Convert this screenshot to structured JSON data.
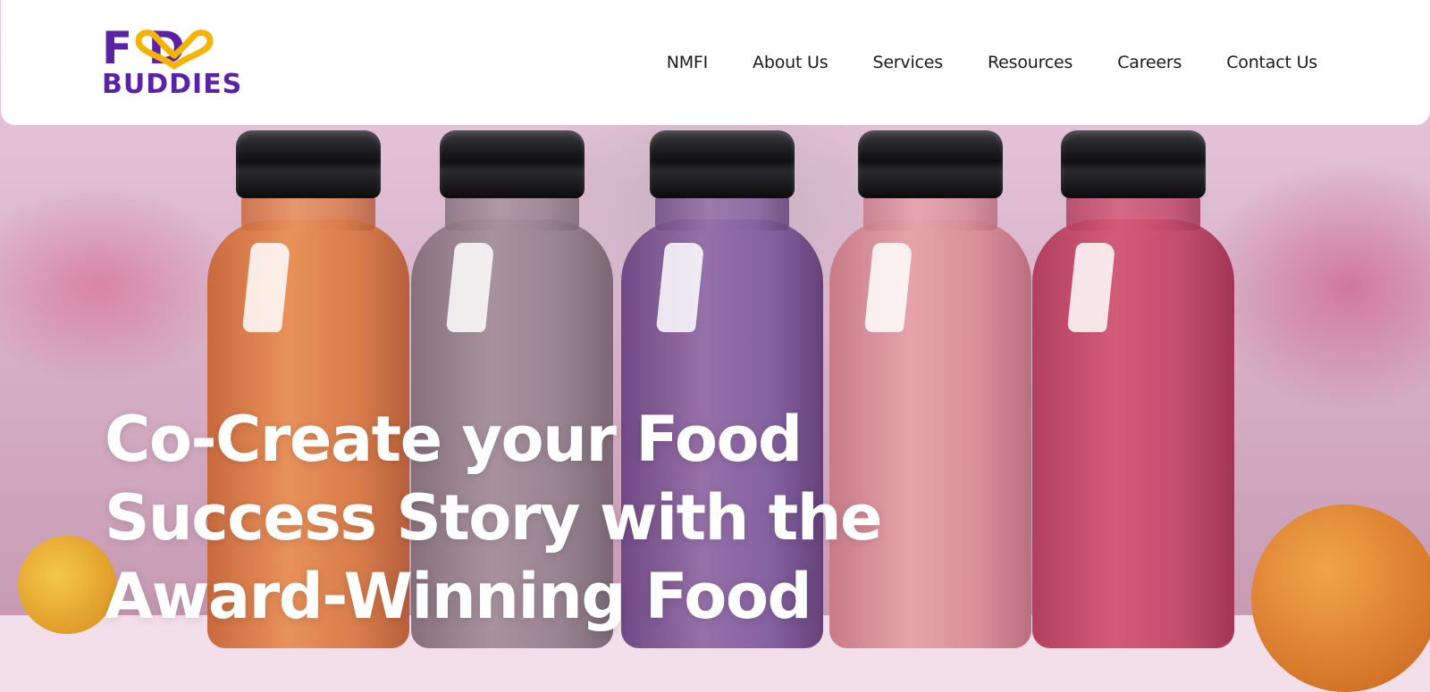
{
  "logo": {
    "line1": "F  D",
    "line2": "BUDDIES"
  },
  "nav": {
    "items": [
      {
        "label": "NMFI"
      },
      {
        "label": "About Us"
      },
      {
        "label": "Services"
      },
      {
        "label": "Resources"
      },
      {
        "label": "Careers"
      },
      {
        "label": "Contact Us"
      }
    ]
  },
  "hero": {
    "headline": "Co-Create your Food Success Story with the Award-Winning Food"
  },
  "colors": {
    "brand_purple": "#5b21a6",
    "brand_yellow": "#f5b400",
    "nav_bg": "#ffffff",
    "headline": "#ffffff"
  },
  "icons": {
    "logo_mark": "heart-loop-icon"
  }
}
